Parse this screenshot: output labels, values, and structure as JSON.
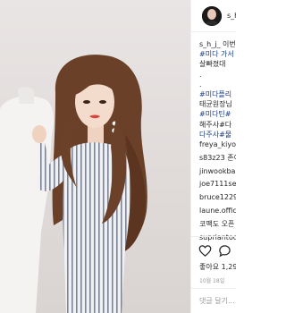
{
  "header": {
    "username": "s_h"
  },
  "caption": {
    "lines": [
      {
        "text": "s_h_j_ 이번",
        "color": "#262626"
      },
      {
        "text": "#미다 가서",
        "color": "#1a3e8f"
      },
      {
        "text": "살빠졌대 ",
        "color": "#262626"
      },
      {
        "text": ".",
        "color": "#262626"
      },
      {
        "text": ".",
        "color": "#262626"
      },
      {
        "text": "#미다플리",
        "color": "#1a3e8f"
      },
      {
        "text": "태균원장님",
        "color": "#262626"
      },
      {
        "text": "#미다틴#",
        "color": "#1a3e8f"
      },
      {
        "text": "해주사#다",
        "color": "#262626"
      },
      {
        "text": "다주사#물",
        "color": "#1a3e8f"
      }
    ]
  },
  "comments": [
    "freya_kiyo",
    "s83z23 존이",
    "jinwookba",
    "joe7111sev",
    "bruce1229",
    "laune.offic",
    "코팩도 오픈",
    "supriantod"
  ],
  "likes": "좋아요 1,29",
  "date": "10월 18일",
  "add_comment_placeholder": "댓글 달기...",
  "colors": {
    "hashtag": "#1a3e8f",
    "muted": "#999999",
    "divider": "#efefef"
  },
  "icons": [
    "heart-icon",
    "comment-icon"
  ]
}
